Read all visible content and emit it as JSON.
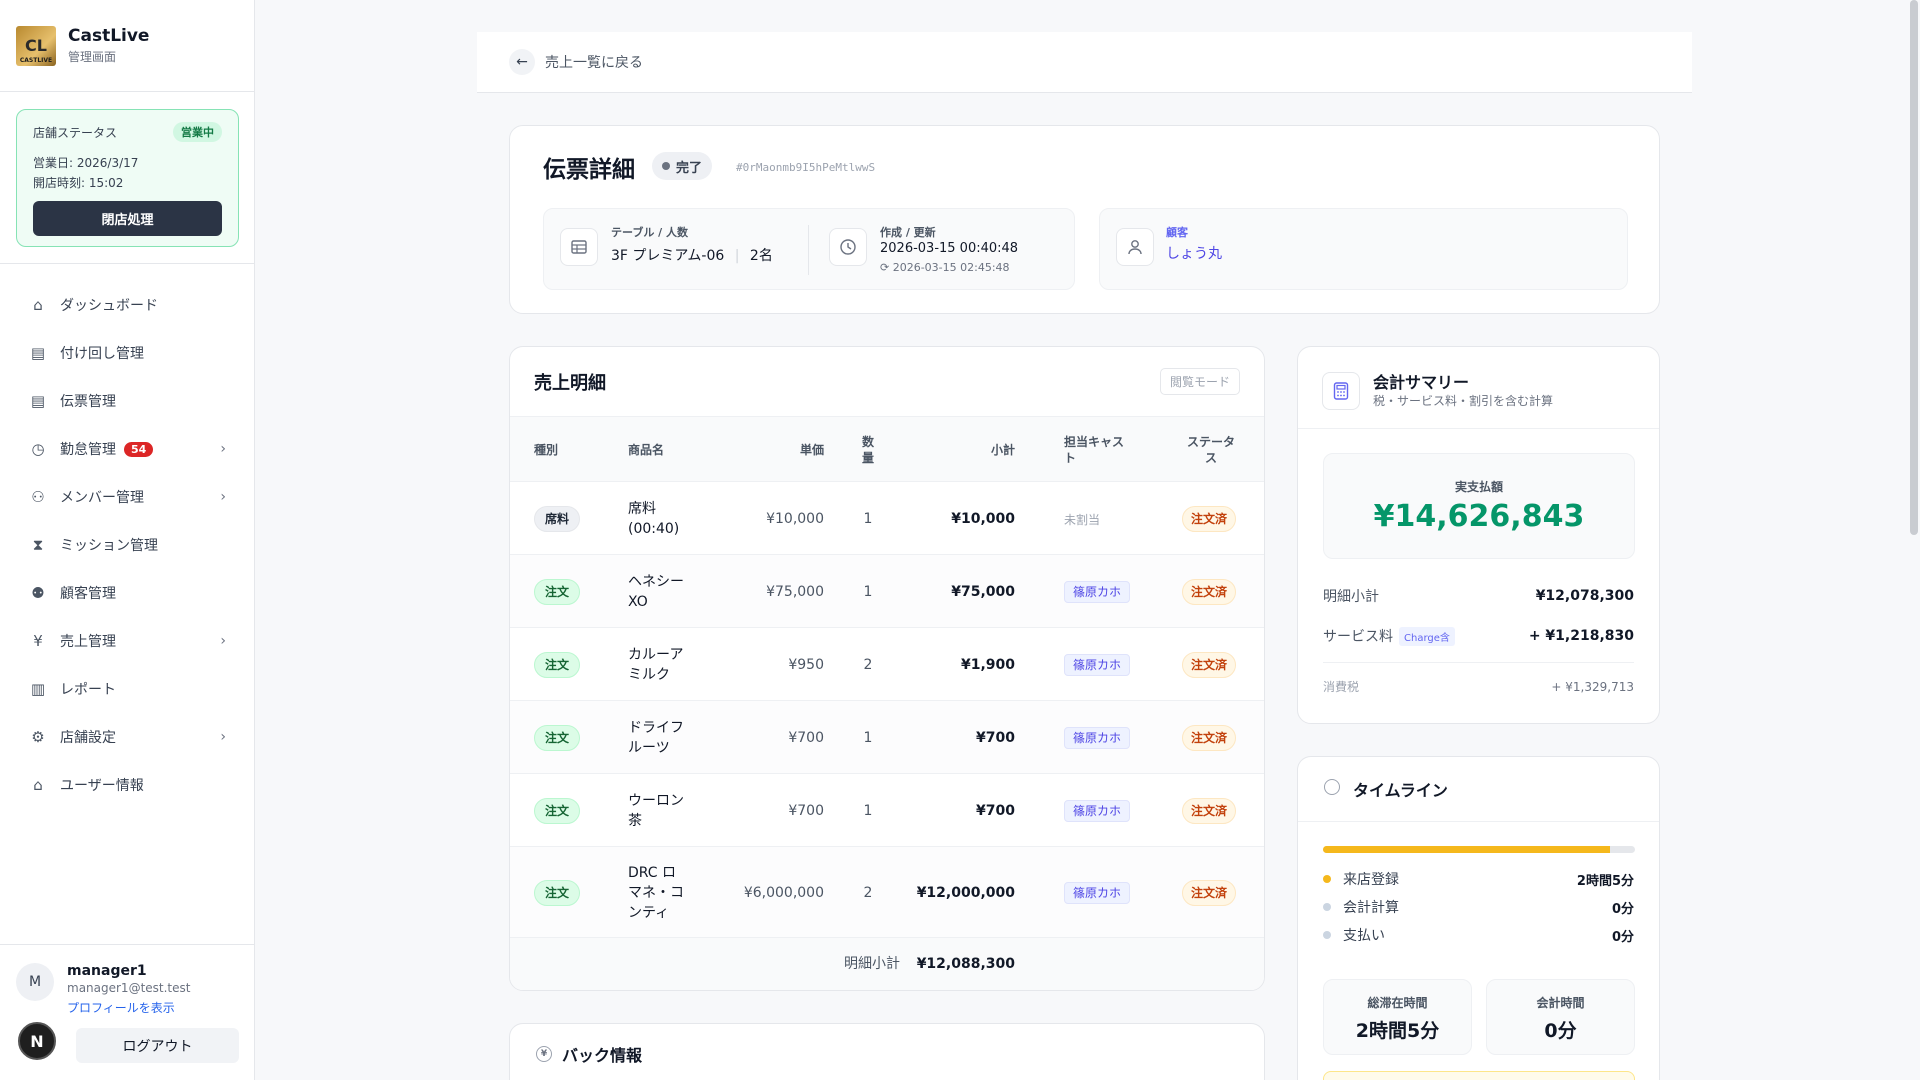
{
  "brand": {
    "name": "CastLive",
    "sub": "管理画面",
    "logo_text": "CL",
    "logo_small": "CASTLIVE"
  },
  "store": {
    "status_label": "店舗ステータス",
    "status_badge": "営業中",
    "business_day": "営業日: 2026/3/17",
    "open_time": "開店時刻: 15:02",
    "close_button": "閉店処理"
  },
  "nav": [
    {
      "label": "ダッシュボード",
      "icon": "home-icon"
    },
    {
      "label": "付け回し管理",
      "icon": "clipboard-icon"
    },
    {
      "label": "伝票管理",
      "icon": "clipboard-icon"
    },
    {
      "label": "勤怠管理",
      "icon": "clock-icon",
      "badge": "54",
      "chevron": true
    },
    {
      "label": "メンバー管理",
      "icon": "users-icon",
      "chevron": true
    },
    {
      "label": "ミッション管理",
      "icon": "hourglass-icon"
    },
    {
      "label": "顧客管理",
      "icon": "group-icon"
    },
    {
      "label": "売上管理",
      "icon": "yen-icon",
      "chevron": true
    },
    {
      "label": "レポート",
      "icon": "bar-chart-icon"
    },
    {
      "label": "店舗設定",
      "icon": "settings-icon",
      "chevron": true
    },
    {
      "label": "ユーザー情報",
      "icon": "home-icon"
    }
  ],
  "user": {
    "avatar": "M",
    "name": "manager1",
    "email": "manager1@test.test",
    "profile_link": "プロフィールを表示",
    "logout": "ログアウト",
    "n_badge": "N"
  },
  "back": {
    "label": "売上一覧に戻る"
  },
  "detail": {
    "title": "伝票詳細",
    "status": "完了",
    "id": "#0rMaonmb9I5hPeMtlwwS",
    "table_label": "テーブル / 人数",
    "table_value": "3F プレミアム-06",
    "people": "2名",
    "time_label": "作成 / 更新",
    "created": "2026-03-15 00:40:48",
    "updated": "2026-03-15 02:45:48",
    "customer_label": "顧客",
    "customer_value": "しょう丸"
  },
  "sales": {
    "title": "売上明細",
    "mode": "閲覧モード",
    "headers": {
      "type": "種別",
      "name": "商品名",
      "price": "単価",
      "qty_1": "数",
      "qty_2": "量",
      "subtotal": "小計",
      "cast_1": "担当キャス",
      "cast_2": "ト",
      "status_1": "ステータ",
      "status_2": "ス"
    },
    "rows": [
      {
        "type": "席料",
        "kind": "seat",
        "name_lines": [
          "席料",
          "(00:40)"
        ],
        "price": "¥10,000",
        "qty": "1",
        "subtotal": "¥10,000",
        "cast": "未割当",
        "cast_assigned": false,
        "status": "注文済"
      },
      {
        "type": "注文",
        "kind": "order",
        "name_lines": [
          "ヘネシー",
          "XO"
        ],
        "price": "¥75,000",
        "qty": "1",
        "subtotal": "¥75,000",
        "cast": "篠原カホ",
        "cast_assigned": true,
        "status": "注文済"
      },
      {
        "type": "注文",
        "kind": "order",
        "name_lines": [
          "カルーア",
          "ミルク"
        ],
        "price": "¥950",
        "qty": "2",
        "subtotal": "¥1,900",
        "cast": "篠原カホ",
        "cast_assigned": true,
        "status": "注文済"
      },
      {
        "type": "注文",
        "kind": "order",
        "name_lines": [
          "ドライフ",
          "ルーツ"
        ],
        "price": "¥700",
        "qty": "1",
        "subtotal": "¥700",
        "cast": "篠原カホ",
        "cast_assigned": true,
        "status": "注文済"
      },
      {
        "type": "注文",
        "kind": "order",
        "name_lines": [
          "ウーロン",
          "茶"
        ],
        "price": "¥700",
        "qty": "1",
        "subtotal": "¥700",
        "cast": "篠原カホ",
        "cast_assigned": true,
        "status": "注文済"
      },
      {
        "type": "注文",
        "kind": "order",
        "name_lines": [
          "DRC ロ",
          "マネ・コ",
          "ンティ"
        ],
        "price": "¥6,000,000",
        "qty": "2",
        "subtotal": "¥12,000,000",
        "cast": "篠原カホ",
        "cast_assigned": true,
        "status": "注文済"
      }
    ],
    "subtotal_label": "明細小計",
    "subtotal_value": "¥12,088,300"
  },
  "back_info": {
    "title": "バック情報"
  },
  "summary": {
    "title": "会計サマリー",
    "subtitle": "税・サービス料・割引を含む計算",
    "pay_label": "実支払額",
    "pay_amount": "¥14,626,843",
    "detail_subtotal_label": "明細小計",
    "detail_subtotal_value": "¥12,078,300",
    "service_label": "サービス料",
    "service_tag": "Charge含",
    "service_value": "+ ¥1,218,830",
    "tax_label": "消費税",
    "tax_value": "+ ¥1,329,713"
  },
  "timeline": {
    "title": "タイムライン",
    "progress": 0.92,
    "colors": {
      "active": "#f5b81c",
      "inactive": "#cbd5e1"
    },
    "steps": [
      {
        "label": "来店登録",
        "value": "2時間5分",
        "active": true
      },
      {
        "label": "会計計算",
        "value": "0分",
        "active": false
      },
      {
        "label": "支払い",
        "value": "0分",
        "active": false
      }
    ],
    "total_label": "総滞在時間",
    "total_value": "2時間5分",
    "checkout_label": "会計時間",
    "checkout_value": "0分"
  }
}
